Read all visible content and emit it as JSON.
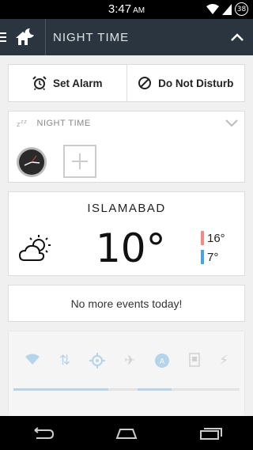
{
  "status_bar": {
    "time": "3:47",
    "ampm": "AM",
    "battery": "38"
  },
  "header": {
    "title": "NIGHT TIME"
  },
  "actions": {
    "alarm_label": "Set Alarm",
    "dnd_label": "Do Not Disturb"
  },
  "night_card": {
    "title": "NIGHT TIME"
  },
  "weather": {
    "city": "ISLAMABAD",
    "temperature": "10°",
    "high": "16°",
    "low": "7°",
    "high_color": "#f28b82",
    "low_color": "#4aa3e0"
  },
  "events": {
    "message": "No more events today!"
  },
  "toggles": {
    "icons": [
      "wifi-icon",
      "data-icon",
      "gps-icon",
      "airplane-icon",
      "auto-brightness-icon",
      "screen-icon",
      "flash-icon"
    ],
    "accent": "#4aa3e0"
  }
}
